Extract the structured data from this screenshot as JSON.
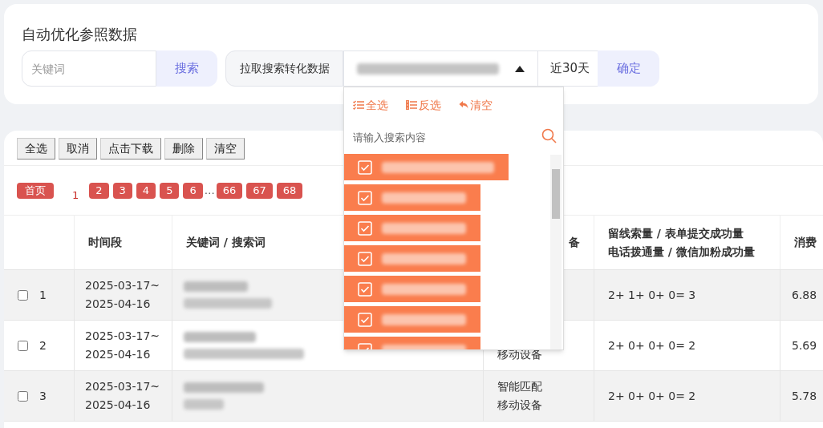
{
  "title": "自动优化参照数据",
  "search": {
    "placeholder": "关键词",
    "button": "搜索"
  },
  "pull": {
    "label": "拉取搜索转化数据",
    "range": "近30天",
    "confirm": "确定",
    "expanded": true
  },
  "dropdown": {
    "actions": [
      {
        "kind": "all",
        "label": "全选"
      },
      {
        "kind": "invert",
        "label": "反选"
      },
      {
        "kind": "clear",
        "label": "清空"
      }
    ],
    "search_placeholder": "请输入搜索内容",
    "options": [
      {
        "checked": true
      },
      {
        "checked": true
      },
      {
        "checked": true
      },
      {
        "checked": true
      },
      {
        "checked": true
      },
      {
        "checked": true
      },
      {
        "checked": true
      }
    ]
  },
  "toolbar": [
    "全选",
    "取消",
    "点击下载",
    "删除",
    "清空"
  ],
  "pagination": {
    "first": "首页",
    "pages": [
      {
        "kind": "page",
        "label": "1",
        "selected": true
      },
      {
        "kind": "page",
        "label": "2",
        "selected": false
      },
      {
        "kind": "page",
        "label": "3",
        "selected": false
      },
      {
        "kind": "page",
        "label": "4",
        "selected": false
      },
      {
        "kind": "page",
        "label": "5",
        "selected": false
      },
      {
        "kind": "page",
        "label": "6",
        "selected": false
      },
      {
        "kind": "ellipsis",
        "label": "…"
      },
      {
        "kind": "page",
        "label": "66",
        "selected": false
      },
      {
        "kind": "page",
        "label": "67",
        "selected": false
      },
      {
        "kind": "page",
        "label": "68",
        "selected": false
      }
    ]
  },
  "table": {
    "columns": [
      [
        "时间段"
      ],
      [
        "关键词 / 搜索词"
      ],
      [
        "备"
      ],
      [
        "留线索量 / 表单提交成功量",
        "电话拨通量 / 微信加粉成功量"
      ],
      [
        "消费"
      ]
    ],
    "rows": [
      {
        "checked": false,
        "index": "1",
        "period": [
          "2025-03-17~",
          "2025-04-16"
        ],
        "device": [],
        "leads": "2+ 1+ 0+ 0= 3",
        "cost": "6.88"
      },
      {
        "checked": false,
        "index": "2",
        "period": [
          "2025-03-17~",
          "2025-04-16"
        ],
        "device": [
          "移动设备"
        ],
        "leads": "2+ 0+ 0+ 0= 2",
        "cost": "5.69"
      },
      {
        "checked": false,
        "index": "3",
        "period": [
          "2025-03-17~",
          "2025-04-16"
        ],
        "device": [
          "智能匹配",
          "移动设备"
        ],
        "leads": "2+ 0+ 0+ 0= 2",
        "cost": "5.78"
      }
    ]
  }
}
